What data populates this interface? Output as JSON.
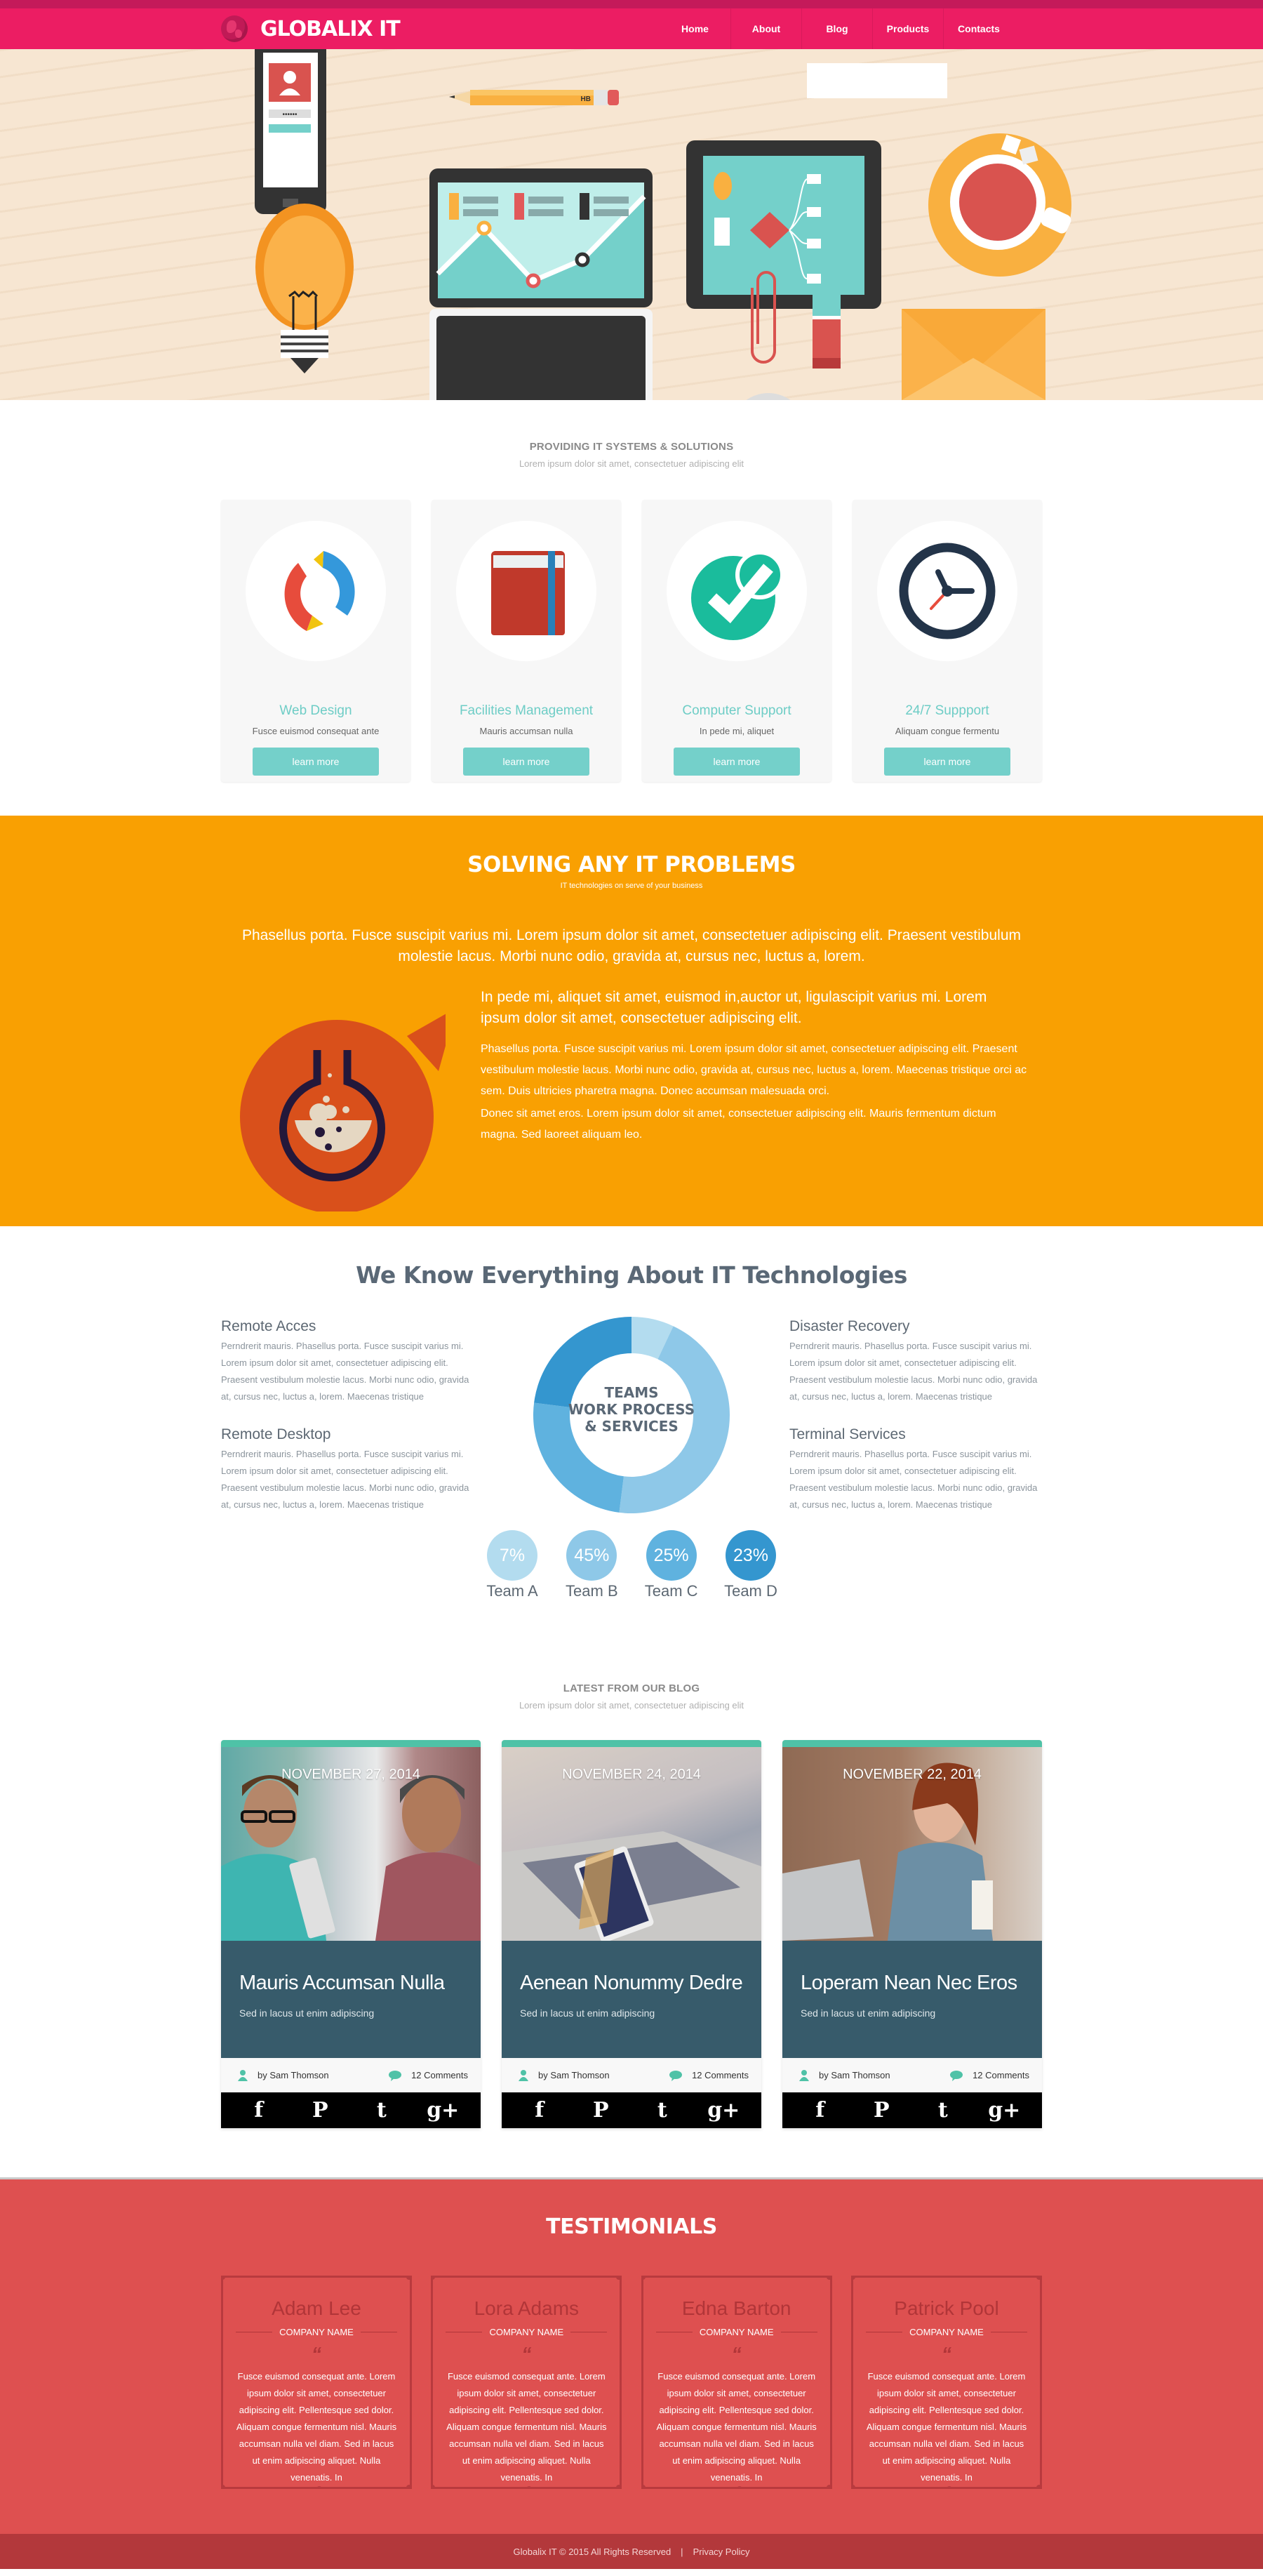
{
  "brand": {
    "name": "GLOBALIX IT"
  },
  "nav": [
    "Home",
    "About",
    "Blog",
    "Products",
    "Contacts"
  ],
  "hero": {
    "pencil_label": "HB",
    "phone_password_mask": "••••••"
  },
  "services": {
    "title": "PROVIDING IT SYSTEMS & SOLUTIONS",
    "subtitle": "Lorem ipsum dolor sit amet, consectetuer adipiscing elit",
    "items": [
      {
        "icon": "pencils-icon",
        "title": "Web Design",
        "text": "Fusce euismod consequat ante",
        "button": "learn more"
      },
      {
        "icon": "book-icon",
        "title": "Facilities Management",
        "text": "Mauris accumsan nulla",
        "button": "learn more"
      },
      {
        "icon": "checkmark-icon",
        "title": "Computer Support",
        "text": "In pede mi, aliquet",
        "button": "learn more"
      },
      {
        "icon": "clock-icon",
        "title": "24/7 Suppport",
        "text": "Aliquam congue fermentu",
        "button": "learn more"
      }
    ]
  },
  "solving": {
    "title": "SOLVING ANY IT PROBLEMS",
    "subtitle": "IT technologies on serve of your business",
    "lead": "Phasellus porta. Fusce suscipit varius mi. Lorem ipsum dolor sit amet, consectetuer adipiscing elit. Praesent vestibulum molestie lacus. Morbi nunc odio, gravida at, cursus nec, luctus a, lorem.",
    "highlight": "In pede mi, aliquet sit amet, euismod in,auctor ut, ligulascipit varius mi. Lorem ipsum dolor sit amet, consectetuer adipiscing elit.",
    "paragraph1": "Phasellus porta. Fusce suscipit varius mi. Lorem ipsum dolor sit amet, consectetuer adipiscing elit. Praesent vestibulum molestie lacus. Morbi nunc odio, gravida at, cursus nec, luctus a, lorem. Maecenas tristique orci ac sem. Duis ultricies pharetra magna. Donec accumsan malesuada orci.",
    "paragraph2": "Donec sit amet eros. Lorem ipsum dolor sit amet, consectetuer adipiscing elit. Mauris fermentum dictum magna. Sed laoreet aliquam leo."
  },
  "tech": {
    "title": "We Know Everything About IT Technologies",
    "left": [
      {
        "title": "Remote Acces",
        "text": "Perndrerit mauris. Phasellus porta. Fusce suscipit varius mi. Lorem ipsum dolor sit amet, consectetuer adipiscing elit. Praesent vestibulum molestie lacus. Morbi nunc odio, gravida at, cursus nec, luctus a, lorem. Maecenas tristique"
      },
      {
        "title": "Remote Desktop",
        "text": "Perndrerit mauris. Phasellus porta. Fusce suscipit varius mi. Lorem ipsum dolor sit amet, consectetuer adipiscing elit. Praesent vestibulum molestie lacus. Morbi nunc odio, gravida at, cursus nec, luctus a, lorem. Maecenas tristique"
      }
    ],
    "right": [
      {
        "title": "Disaster Recovery",
        "text": "Perndrerit mauris. Phasellus porta. Fusce suscipit varius mi. Lorem ipsum dolor sit amet, consectetuer adipiscing elit. Praesent vestibulum molestie lacus. Morbi nunc odio, gravida at, cursus nec, luctus a, lorem. Maecenas tristique"
      },
      {
        "title": "Terminal Services",
        "text": "Perndrerit mauris. Phasellus porta. Fusce suscipit varius mi. Lorem ipsum dolor sit amet, consectetuer adipiscing elit. Praesent vestibulum molestie lacus. Morbi nunc odio, gravida at, cursus nec, luctus a, lorem. Maecenas tristique"
      }
    ]
  },
  "chart_data": {
    "type": "pie",
    "title": "TEAMS WORK PROCESS & SERVICES",
    "title_lines": [
      "TEAMS",
      "WORK PROCESS",
      "& SERVICES"
    ],
    "categories": [
      "Team A",
      "Team B",
      "Team C",
      "Team D"
    ],
    "values": [
      7,
      45,
      25,
      23
    ],
    "labels": [
      "7%",
      "45%",
      "25%",
      "23%"
    ],
    "colors": [
      "#b3dcef",
      "#8ec8e8",
      "#5fb2df",
      "#3496cf"
    ],
    "donut": true,
    "legend": "bottom"
  },
  "blog": {
    "title": "LATEST FROM OUR BLOG",
    "subtitle": "Lorem ipsum dolor sit amet, consectetuer adipiscing elit",
    "posts": [
      {
        "date": "NOVEMBER 27, 2014",
        "title": "Mauris Accumsan Nulla",
        "excerpt": "Sed in lacus ut enim adipiscing",
        "author": "by Sam Thomson",
        "comments": "12 Comments",
        "image": "two-men-at-office-photo"
      },
      {
        "date": "NOVEMBER 24, 2014",
        "title": "Aenean Nonummy Dedre",
        "excerpt": "Sed in lacus ut enim adipiscing",
        "author": "by Sam Thomson",
        "comments": "12 Comments",
        "image": "laptop-and-phone-photo"
      },
      {
        "date": "NOVEMBER 22, 2014",
        "title": "Loperam Nean Nec Eros",
        "excerpt": "Sed in lacus ut enim adipiscing",
        "author": "by Sam Thomson",
        "comments": "12 Comments",
        "image": "woman-with-laptop-photo"
      }
    ],
    "social": [
      "f",
      "P",
      "t",
      "g+"
    ]
  },
  "testimonials": {
    "title": "TESTIMONIALS",
    "items": [
      {
        "name": "Adam Lee",
        "company": "COMPANY NAME",
        "quote_mark": "“",
        "text": "Fusce euismod consequat ante. Lorem ipsum dolor sit amet, consectetuer adipiscing elit. Pellentesque sed dolor. Aliquam congue fermentum nisl. Mauris accumsan nulla vel diam. Sed in lacus ut enim adipiscing aliquet. Nulla venenatis. In"
      },
      {
        "name": "Lora Adams",
        "company": "COMPANY NAME",
        "quote_mark": "“",
        "text": "Fusce euismod consequat ante. Lorem ipsum dolor sit amet, consectetuer adipiscing elit. Pellentesque sed dolor. Aliquam congue fermentum nisl. Mauris accumsan nulla vel diam. Sed in lacus ut enim adipiscing aliquet. Nulla venenatis. In"
      },
      {
        "name": "Edna Barton",
        "company": "COMPANY NAME",
        "quote_mark": "“",
        "text": "Fusce euismod consequat ante. Lorem ipsum dolor sit amet, consectetuer adipiscing elit. Pellentesque sed dolor. Aliquam congue fermentum nisl. Mauris accumsan nulla vel diam. Sed in lacus ut enim adipiscing aliquet. Nulla venenatis. In"
      },
      {
        "name": "Patrick Pool",
        "company": "COMPANY NAME",
        "quote_mark": "“",
        "text": "Fusce euismod consequat ante. Lorem ipsum dolor sit amet, consectetuer adipiscing elit. Pellentesque sed dolor. Aliquam congue fermentum nisl. Mauris accumsan nulla vel diam. Sed in lacus ut enim adipiscing aliquet. Nulla venenatis. In"
      }
    ]
  },
  "footer": {
    "copyright": "Globalix IT © 2015 All Rights Reserved",
    "separator": "|",
    "privacy": "Privacy Policy"
  },
  "colors": {
    "brand_pink": "#ec1d63",
    "teal": "#74d0ca",
    "orange": "#f9a002",
    "blog_dark": "#375b6b",
    "testimonial_red": "#de5050",
    "footer_red": "#b3383b"
  }
}
